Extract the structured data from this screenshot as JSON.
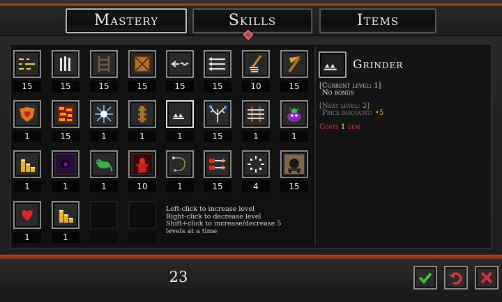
{
  "tabs": [
    {
      "label": "Mastery",
      "active": true
    },
    {
      "label": "Skills",
      "active": false
    },
    {
      "label": "Items",
      "active": false
    }
  ],
  "grid": {
    "rows": [
      [
        {
          "icon": "dash-arrows-icon",
          "count": "15"
        },
        {
          "icon": "vertical-bars-icon",
          "count": "15"
        },
        {
          "icon": "ladder-icon",
          "count": "15"
        },
        {
          "icon": "crate-icon",
          "count": "15"
        },
        {
          "icon": "arrow-trail-icon",
          "count": "15"
        },
        {
          "icon": "triple-arrows-icon",
          "count": "15"
        },
        {
          "icon": "drill-icon",
          "count": "10"
        },
        {
          "icon": "pickaxe-icon",
          "count": "15"
        }
      ],
      [
        {
          "icon": "heart-shield-icon",
          "count": "1"
        },
        {
          "icon": "lava-block-icon",
          "count": "15"
        },
        {
          "icon": "spark-burst-icon",
          "count": "1"
        },
        {
          "icon": "rope-knot-icon",
          "count": "1"
        },
        {
          "icon": "grinder-icon",
          "count": "1",
          "selected": true
        },
        {
          "icon": "lightning-tree-icon",
          "count": "15"
        },
        {
          "icon": "fence-arrows-icon",
          "count": "1"
        },
        {
          "icon": "goblin-face-icon",
          "count": "1"
        }
      ],
      [
        {
          "icon": "gold-stack-icon",
          "count": "1"
        },
        {
          "icon": "dark-orb-icon",
          "count": "1"
        },
        {
          "icon": "green-lizard-icon",
          "count": "1"
        },
        {
          "icon": "red-demon-icon",
          "count": "10"
        },
        {
          "icon": "whip-icon",
          "count": "1"
        },
        {
          "icon": "fire-arrows-icon",
          "count": "15"
        },
        {
          "icon": "sparkle-ring-icon",
          "count": "4"
        },
        {
          "icon": "bomb-cart-icon",
          "count": "15"
        }
      ],
      [
        {
          "icon": "heart-icon",
          "count": "1"
        },
        {
          "icon": "gold-stack-icon",
          "count": "1"
        },
        {
          "icon": "empty-slot",
          "count": ""
        },
        {
          "icon": "empty-slot",
          "count": ""
        }
      ]
    ]
  },
  "hint": {
    "line1": "Left-click to increase level",
    "line2": "Right-click to decrease level",
    "line3": "Shift+click to increase/decrease 5",
    "line4": "levels at a time"
  },
  "info": {
    "name": "Grinder",
    "icon": "grinder-icon",
    "current_level": "[Current level: 1]",
    "current_effect": "No bonus",
    "next_level": "[Next level: 2]",
    "next_effect_label": "Price discount:",
    "next_effect_value": "•5",
    "cost_prefix": "Costs",
    "cost_amount": "1",
    "cost_unit": "gem"
  },
  "footer": {
    "total": "23",
    "buttons": [
      {
        "icon": "check-icon",
        "color": "#3fbf3a"
      },
      {
        "icon": "undo-icon",
        "color": "#d8323a"
      },
      {
        "icon": "close-icon",
        "color": "#d8323a"
      }
    ]
  },
  "colors": {
    "accent_bar": "#a9411f",
    "cost_red": "#d6453f",
    "gold": "#d6b442"
  }
}
